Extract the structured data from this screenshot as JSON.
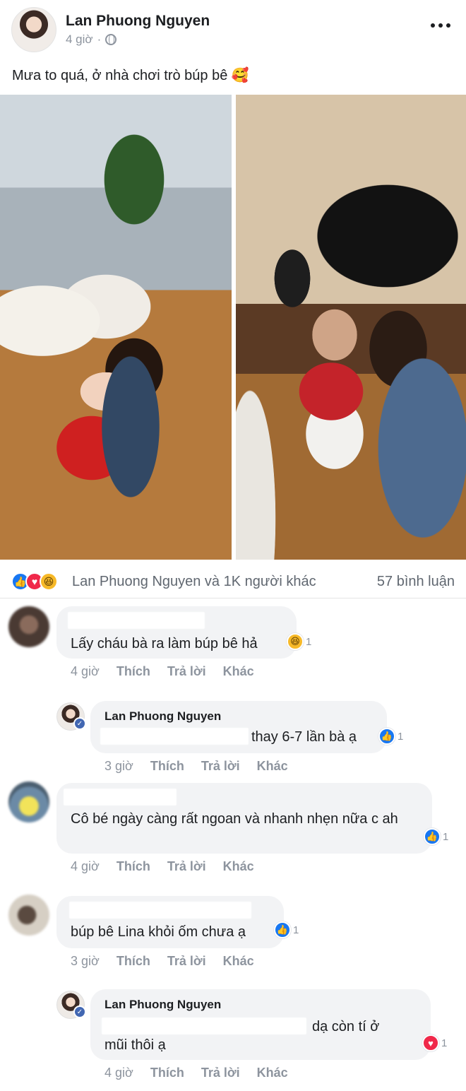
{
  "post": {
    "author": "Lan Phuong Nguyen",
    "time": "4 giờ",
    "separator": "·",
    "text": "Mưa to quá, ở nhà chơi trò búp bê 🥰"
  },
  "reactions": {
    "summary": "Lan Phuong Nguyen và 1K người khác",
    "comments": "57 bình luận",
    "icons": [
      "like-icon",
      "love-icon",
      "haha-icon"
    ],
    "colors": {
      "like": "#1877f2",
      "love": "#f0284a",
      "haha": "#f7b928"
    }
  },
  "actions": {
    "like": "Thích",
    "reply": "Trả lời",
    "more": "Khác"
  },
  "comments": [
    {
      "text": "Lấy cháu bà ra làm búp bê hả",
      "time": "4 giờ",
      "reaction_count": "1",
      "reaction": "haha"
    },
    {
      "author": "Lan Phuong Nguyen",
      "text": "thay 6-7 lần bà ạ",
      "time": "3 giờ",
      "reaction_count": "1",
      "reaction": "like"
    },
    {
      "text": "Cô bé ngày càng rất ngoan và nhanh nhẹn nữa c ah",
      "time": "4 giờ",
      "reaction_count": "1",
      "reaction": "like"
    },
    {
      "text": "búp bê Lina khỏi ốm chưa ạ",
      "time": "3 giờ",
      "reaction_count": "1",
      "reaction": "like"
    },
    {
      "author": "Lan Phuong Nguyen",
      "text": "dạ còn tí ở",
      "text2": "mũi thôi ạ",
      "time": "4 giờ",
      "reaction_count": "1",
      "reaction": "love"
    }
  ]
}
